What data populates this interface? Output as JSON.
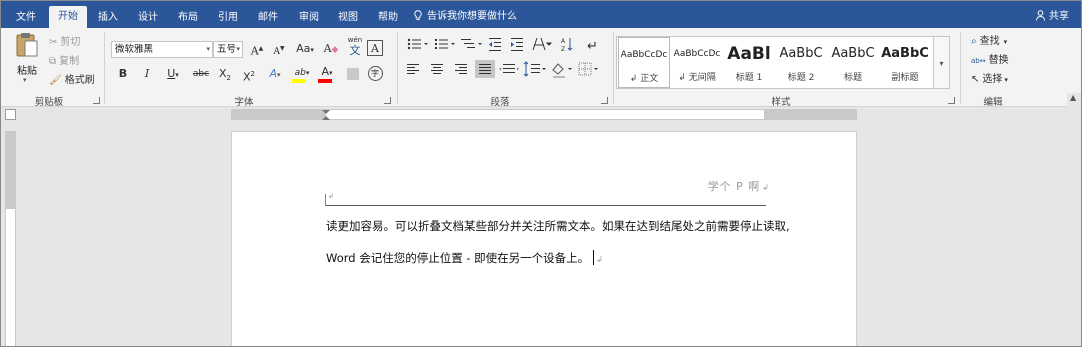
{
  "tabs": [
    {
      "label": "文件",
      "active": false
    },
    {
      "label": "开始",
      "active": true
    },
    {
      "label": "插入",
      "active": false
    },
    {
      "label": "设计",
      "active": false
    },
    {
      "label": "布局",
      "active": false
    },
    {
      "label": "引用",
      "active": false
    },
    {
      "label": "邮件",
      "active": false
    },
    {
      "label": "审阅",
      "active": false
    },
    {
      "label": "视图",
      "active": false
    },
    {
      "label": "帮助",
      "active": false
    }
  ],
  "tell_me": "告诉我你想要做什么",
  "share": "共享",
  "clipboard": {
    "paste": "粘贴",
    "cut": "剪切",
    "copy": "复制",
    "format_painter": "格式刷",
    "group_label": "剪贴板"
  },
  "font": {
    "font_name": "微软雅黑",
    "font_size": "五号",
    "group_label": "字体",
    "wen_top": "wén",
    "wen_char": "文",
    "grow": "A",
    "shrink": "A",
    "case": "Aa",
    "clear": "A",
    "border_char": "A",
    "bold": "B",
    "italic": "I",
    "underline": "U",
    "strike": "abc",
    "sub": "X",
    "sub_mark": "2",
    "sup": "X",
    "sup_mark": "2",
    "effect": "A",
    "highlight": "ab",
    "color": "A",
    "enclose": "字"
  },
  "paragraph": {
    "group_label": "段落"
  },
  "styles": {
    "group_label": "样式",
    "items": [
      {
        "sample": "AaBbCcDc",
        "name": "正文",
        "active": true
      },
      {
        "sample": "AaBbCcDc",
        "name": "无间隔",
        "active": false
      },
      {
        "sample": "AaBl",
        "name": "标题 1",
        "active": false
      },
      {
        "sample": "AaBbC",
        "name": "标题 2",
        "active": false
      },
      {
        "sample": "AaBbC",
        "name": "标题",
        "active": false
      },
      {
        "sample": "AaBbC",
        "name": "副标题",
        "active": false
      }
    ]
  },
  "editing": {
    "find": "查找",
    "replace": "替换",
    "select": "选择",
    "group_label": "编辑"
  },
  "document": {
    "header_text": "学个 P 啊",
    "line1": "读更加容易。可以折叠文档某些部分并关注所需文本。如果在达到结尾处之前需要停止读取,",
    "line2": "Word 会记住您的停止位置 - 即使在另一个设备上。"
  },
  "colors": {
    "accent": "#2b579a",
    "highlight_yellow": "#ffff00",
    "font_red": "#ff0000"
  }
}
